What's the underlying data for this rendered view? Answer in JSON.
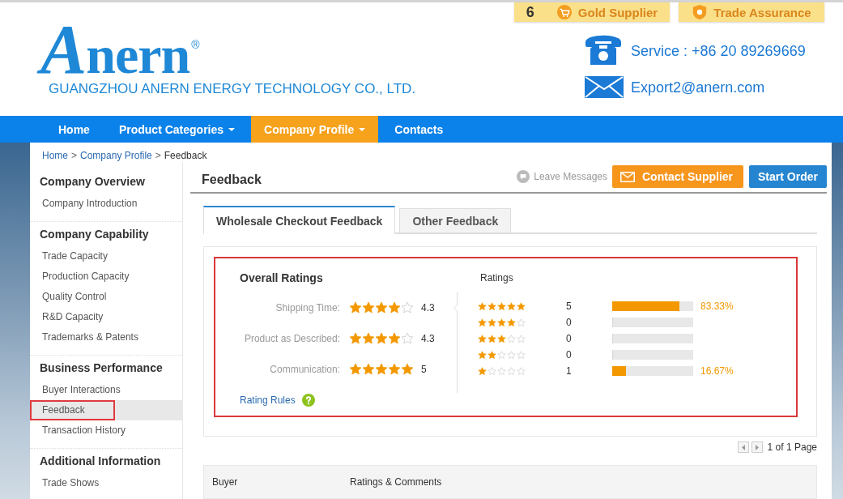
{
  "header": {
    "logo": {
      "wordmark": "Anern",
      "registered_mark": "®"
    },
    "company_name": "GUANGZHOU ANERN ENERGY TECHNOLOGY CO., LTD.",
    "badges": [
      {
        "kind": "gold_supplier",
        "years": "6",
        "label": "Gold Supplier"
      },
      {
        "kind": "trade_assurance",
        "label": "Trade Assurance"
      }
    ],
    "contacts": [
      {
        "kind": "phone",
        "text": "Service : +86 20 89269669"
      },
      {
        "kind": "email",
        "text": "Export2@anern.com"
      }
    ]
  },
  "nav": [
    {
      "label": "Home",
      "dropdown": false,
      "selected": false
    },
    {
      "label": "Product Categories",
      "dropdown": true,
      "selected": false
    },
    {
      "label": "Company Profile",
      "dropdown": true,
      "selected": true
    },
    {
      "label": "Contacts",
      "dropdown": false,
      "selected": false
    }
  ],
  "breadcrumb": [
    {
      "kind": "link",
      "text": "Home"
    },
    {
      "kind": "separator",
      "text": ">"
    },
    {
      "kind": "link",
      "text": "Company Profile"
    },
    {
      "kind": "separator",
      "text": ">"
    },
    {
      "kind": "current",
      "text": "Feedback"
    }
  ],
  "sidebar": {
    "sections": [
      {
        "title": "Company Overview",
        "items": [
          {
            "label": "Company Introduction",
            "selected": false,
            "outlined": false
          }
        ]
      },
      {
        "title": "Company Capability",
        "items": [
          {
            "label": "Trade Capacity",
            "selected": false,
            "outlined": false
          },
          {
            "label": "Production Capacity",
            "selected": false,
            "outlined": false
          },
          {
            "label": "Quality Control",
            "selected": false,
            "outlined": false
          },
          {
            "label": "R&D Capacity",
            "selected": false,
            "outlined": false
          },
          {
            "label": "Trademarks & Patents",
            "selected": false,
            "outlined": false
          }
        ]
      },
      {
        "title": "Business Performance",
        "items": [
          {
            "label": "Buyer Interactions",
            "selected": false,
            "outlined": false
          },
          {
            "label": "Feedback",
            "selected": true,
            "outlined": true
          },
          {
            "label": "Transaction History",
            "selected": false,
            "outlined": false
          }
        ]
      },
      {
        "title": "Additional Information",
        "items": [
          {
            "label": "Trade Shows",
            "selected": false,
            "outlined": false
          }
        ]
      }
    ]
  },
  "main": {
    "title": "Feedback",
    "leave_messages": "Leave Messages",
    "buttons": [
      {
        "kind": "contact",
        "label": "Contact Supplier"
      },
      {
        "kind": "order",
        "label": "Start Order"
      }
    ],
    "tabs": [
      {
        "label": "Wholesale Checkout Feedback",
        "selected": true
      },
      {
        "label": "Other Feedback",
        "selected": false
      }
    ],
    "ratings_panel": {
      "outlined": true,
      "overall_title": "Overall Ratings",
      "overall": [
        {
          "label": "Shipping Time:",
          "stars": 4,
          "value": "4.3"
        },
        {
          "label": "Product as Described:",
          "stars": 4,
          "value": "4.3"
        },
        {
          "label": "Communication:",
          "stars": 5,
          "value": "5"
        }
      ],
      "distribution_title": "Ratings",
      "distribution": [
        {
          "stars": 5,
          "count": "5",
          "level": 0.8333,
          "percent": "83.33%"
        },
        {
          "stars": 4,
          "count": "0",
          "level": 0
        },
        {
          "stars": 3,
          "count": "0",
          "level": 0
        },
        {
          "stars": 2,
          "count": "0",
          "level": 0
        },
        {
          "stars": 1,
          "count": "1",
          "level": 0.1667,
          "percent": "16.67%"
        }
      ],
      "rules_link": "Rating Rules"
    },
    "pagination": "1 of 1 Page",
    "table": {
      "columns": [
        "Buyer",
        "Ratings & Comments"
      ]
    }
  }
}
